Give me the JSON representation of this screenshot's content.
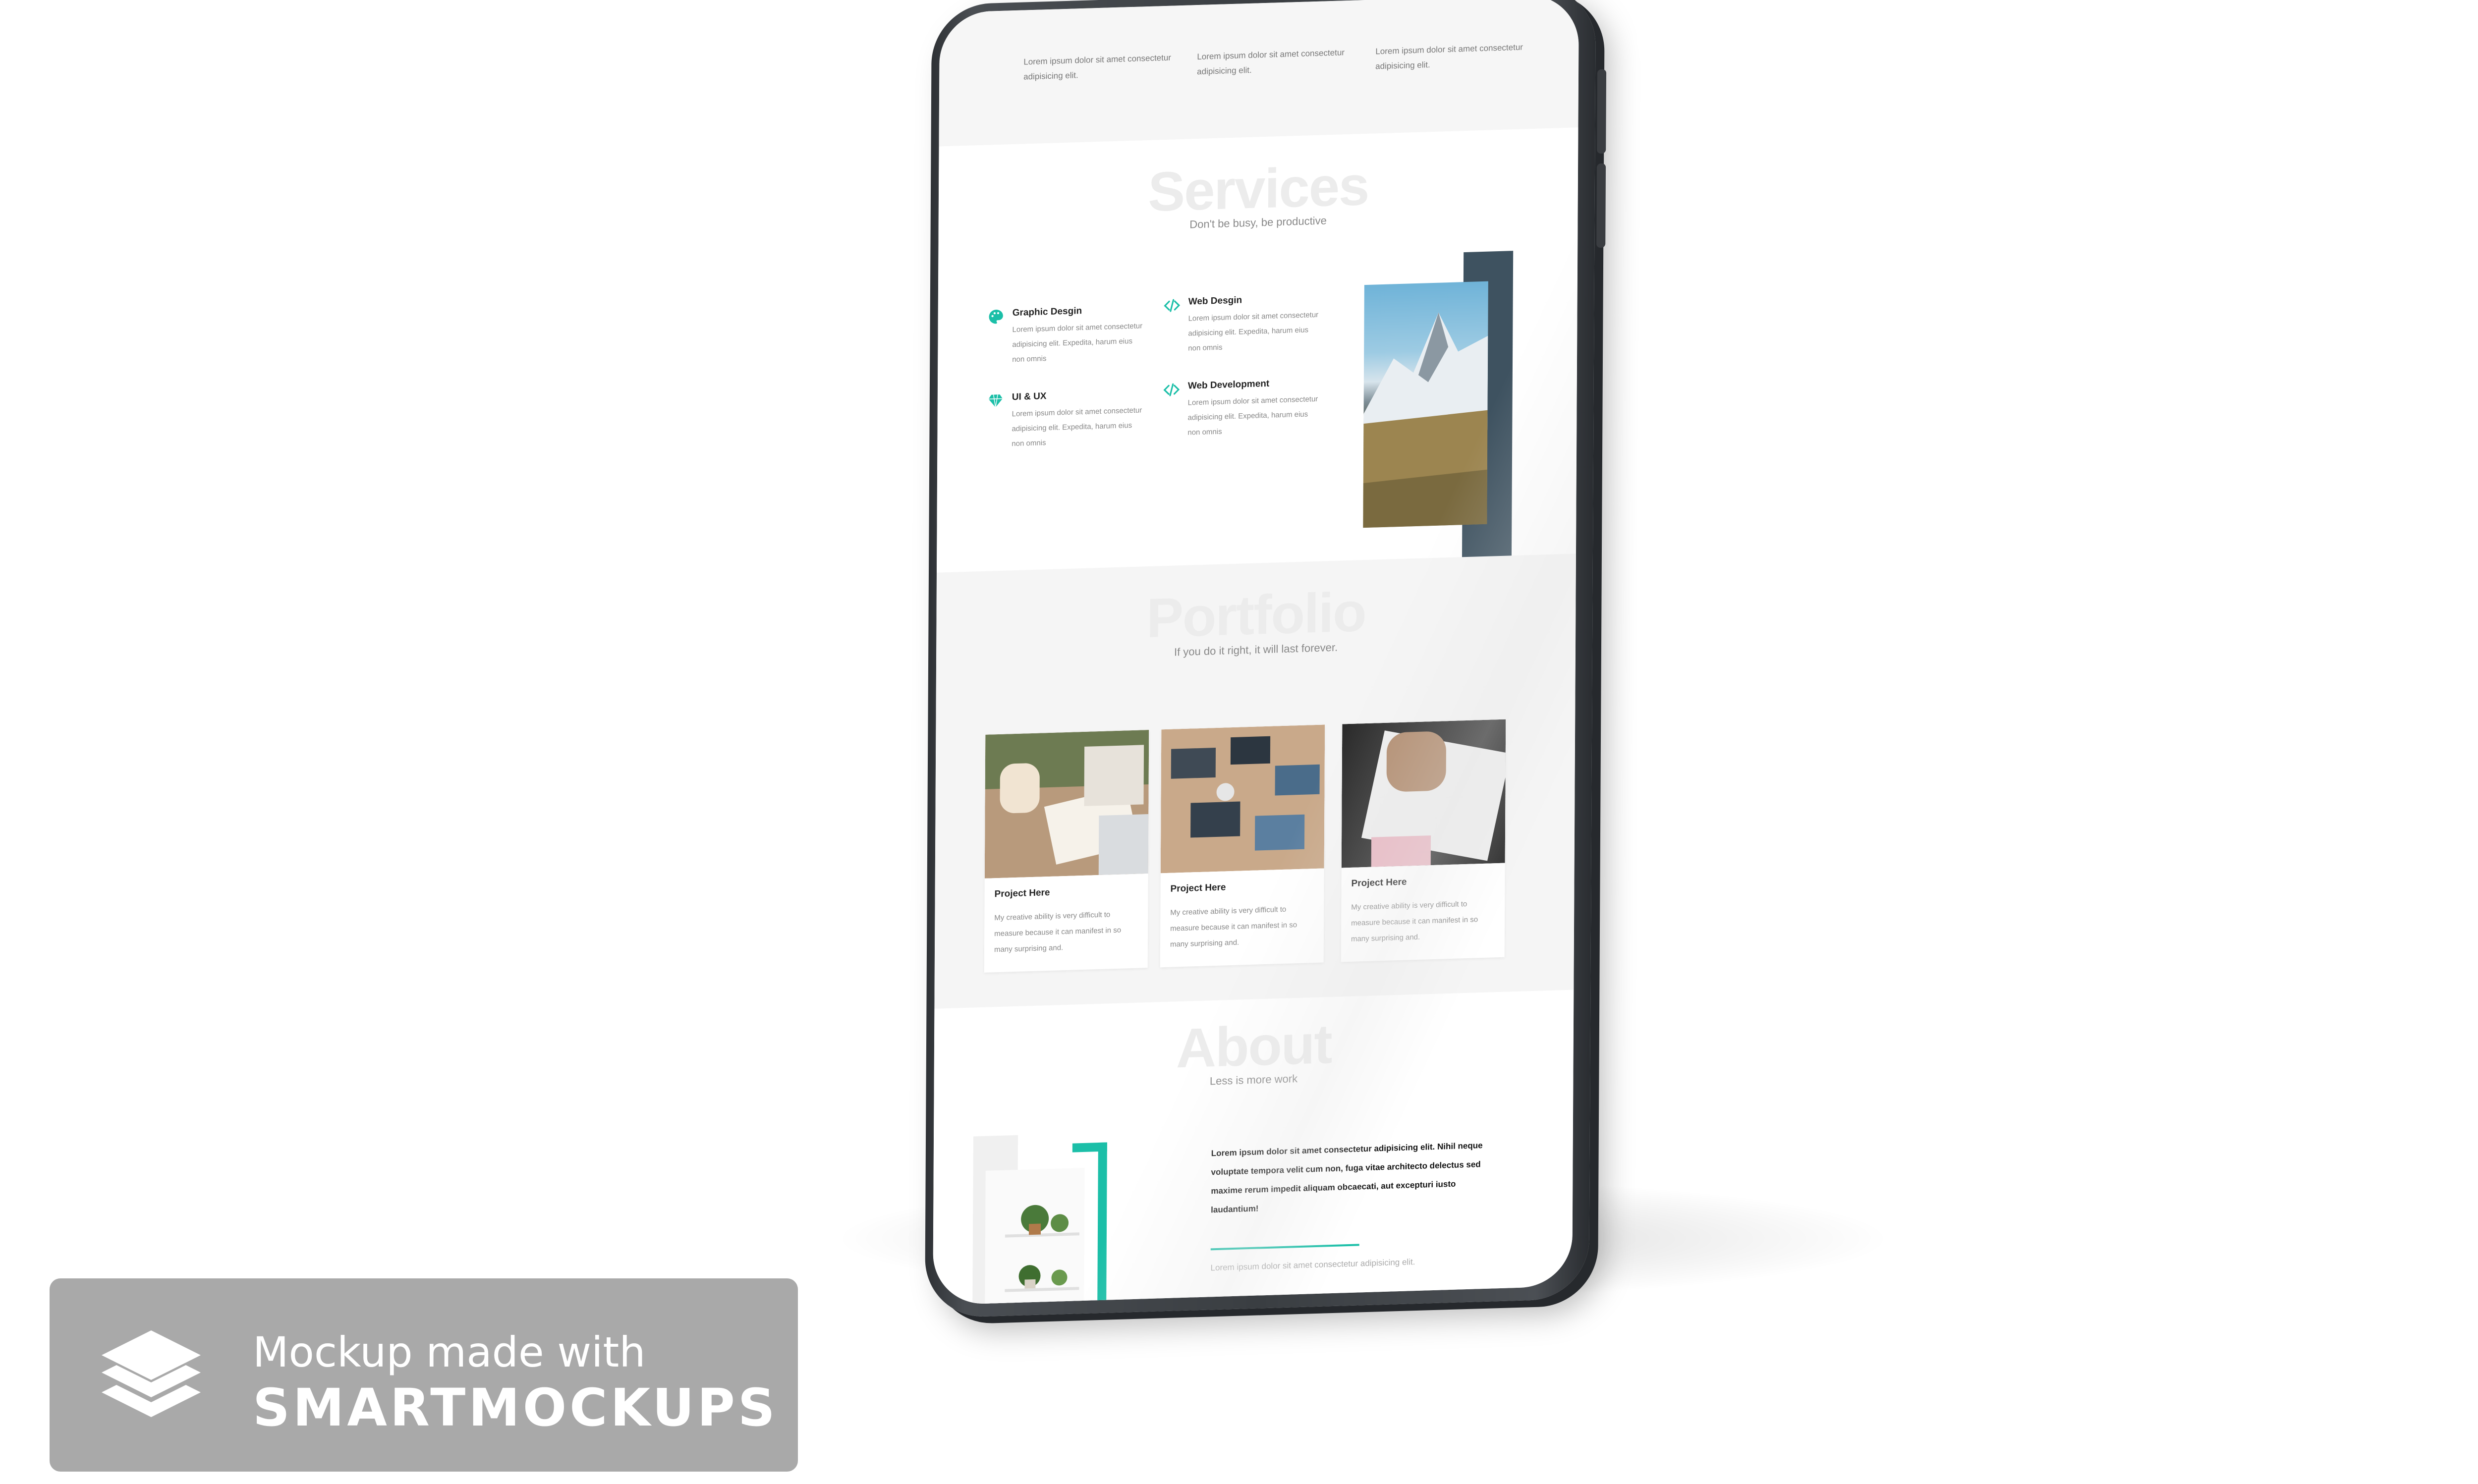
{
  "top_columns": [
    {
      "text": "Lorem ipsum dolor sit amet consectetur adipisicing elit."
    },
    {
      "text": "Lorem ipsum dolor sit amet consectetur adipisicing elit."
    },
    {
      "text": "Lorem ipsum dolor sit amet consectetur adipisicing elit."
    }
  ],
  "services": {
    "heading": "Services",
    "subheading": "Don't be busy, be productive",
    "items": [
      {
        "title": "Graphic Desgin",
        "text": "Lorem ipsum dolor sit amet consectetur adipisicing elit. Expedita, harum eius non omnis",
        "icon": "palette-icon"
      },
      {
        "title": "Web Desgin",
        "text": "Lorem ipsum dolor sit amet consectetur adipisicing elit. Expedita, harum eius non omnis",
        "icon": "code-icon"
      },
      {
        "title": "UI & UX",
        "text": "Lorem ipsum dolor sit amet consectetur adipisicing elit. Expedita, harum eius non omnis",
        "icon": "diamond-icon"
      },
      {
        "title": "Web Development",
        "text": "Lorem ipsum dolor sit amet consectetur adipisicing elit. Expedita, harum eius non omnis",
        "icon": "code-icon"
      }
    ]
  },
  "portfolio": {
    "heading": "Portfolio",
    "subheading": "If you do it right, it will last forever.",
    "cards": [
      {
        "title": "Project Here",
        "text": "My creative ability is very difficult to measure because it can manifest in so many surprising and."
      },
      {
        "title": "Project Here",
        "text": "My creative ability is very difficult to measure because it can manifest in so many surprising and."
      },
      {
        "title": "Project Here",
        "text": "My creative ability is very difficult to measure because it can manifest in so many surprising and."
      }
    ]
  },
  "about": {
    "heading": "About",
    "subheading": "Less is more work",
    "text": "Lorem ipsum dolor sit amet consectetur adipisicing elit. Nihil neque voluptate tempora velit cum non, fuga vitae architecto delectus sed maxime rerum impedit aliquam obcaecati, aut excepturi iusto laudantium!",
    "bottom_text": "Lorem ipsum dolor sit amet consectetur adipisicing elit."
  },
  "watermark": {
    "line1": "Mockup made with",
    "line2": "SMARTMOCKUPS"
  },
  "colors": {
    "accent": "#1bbfa8",
    "slate": "#3e5260",
    "device": "#3a3e42"
  }
}
